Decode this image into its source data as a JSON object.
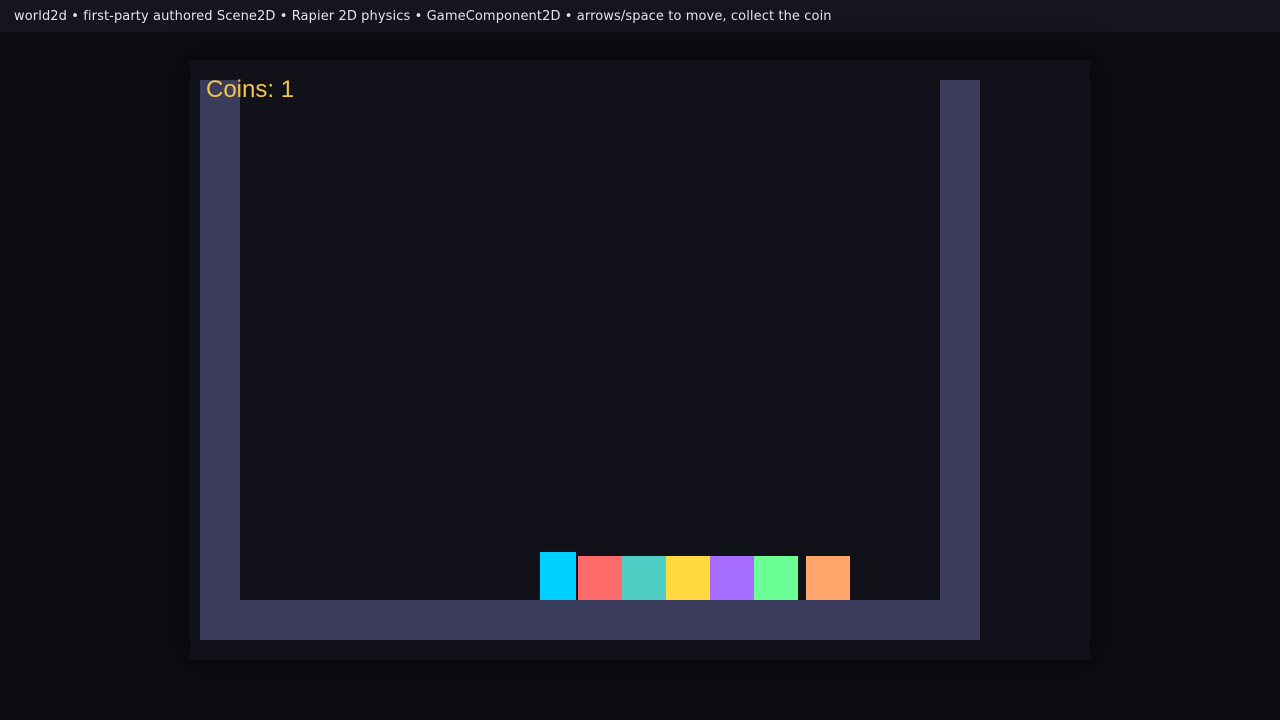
{
  "header": {
    "caption": "world2d • first-party authored Scene2D • Rapier 2D physics • GameComponent2D • arrows/space to move, collect the coin"
  },
  "hud": {
    "coins_text": "Coins: 1",
    "color": "#f4c44e"
  },
  "scene": {
    "wall_color": "#3b3c5b",
    "background_color": "#11111a",
    "player": {
      "name": "player",
      "color": "#00d0ff"
    },
    "boxes": [
      {
        "name": "box-red",
        "color": "#ff6b6b"
      },
      {
        "name": "box-teal",
        "color": "#4ecdc4"
      },
      {
        "name": "box-yellow",
        "color": "#ffd93d"
      },
      {
        "name": "box-purple",
        "color": "#a66cff"
      },
      {
        "name": "box-green",
        "color": "#6bff95"
      },
      {
        "name": "box-orange",
        "color": "#ffa46b"
      }
    ]
  }
}
